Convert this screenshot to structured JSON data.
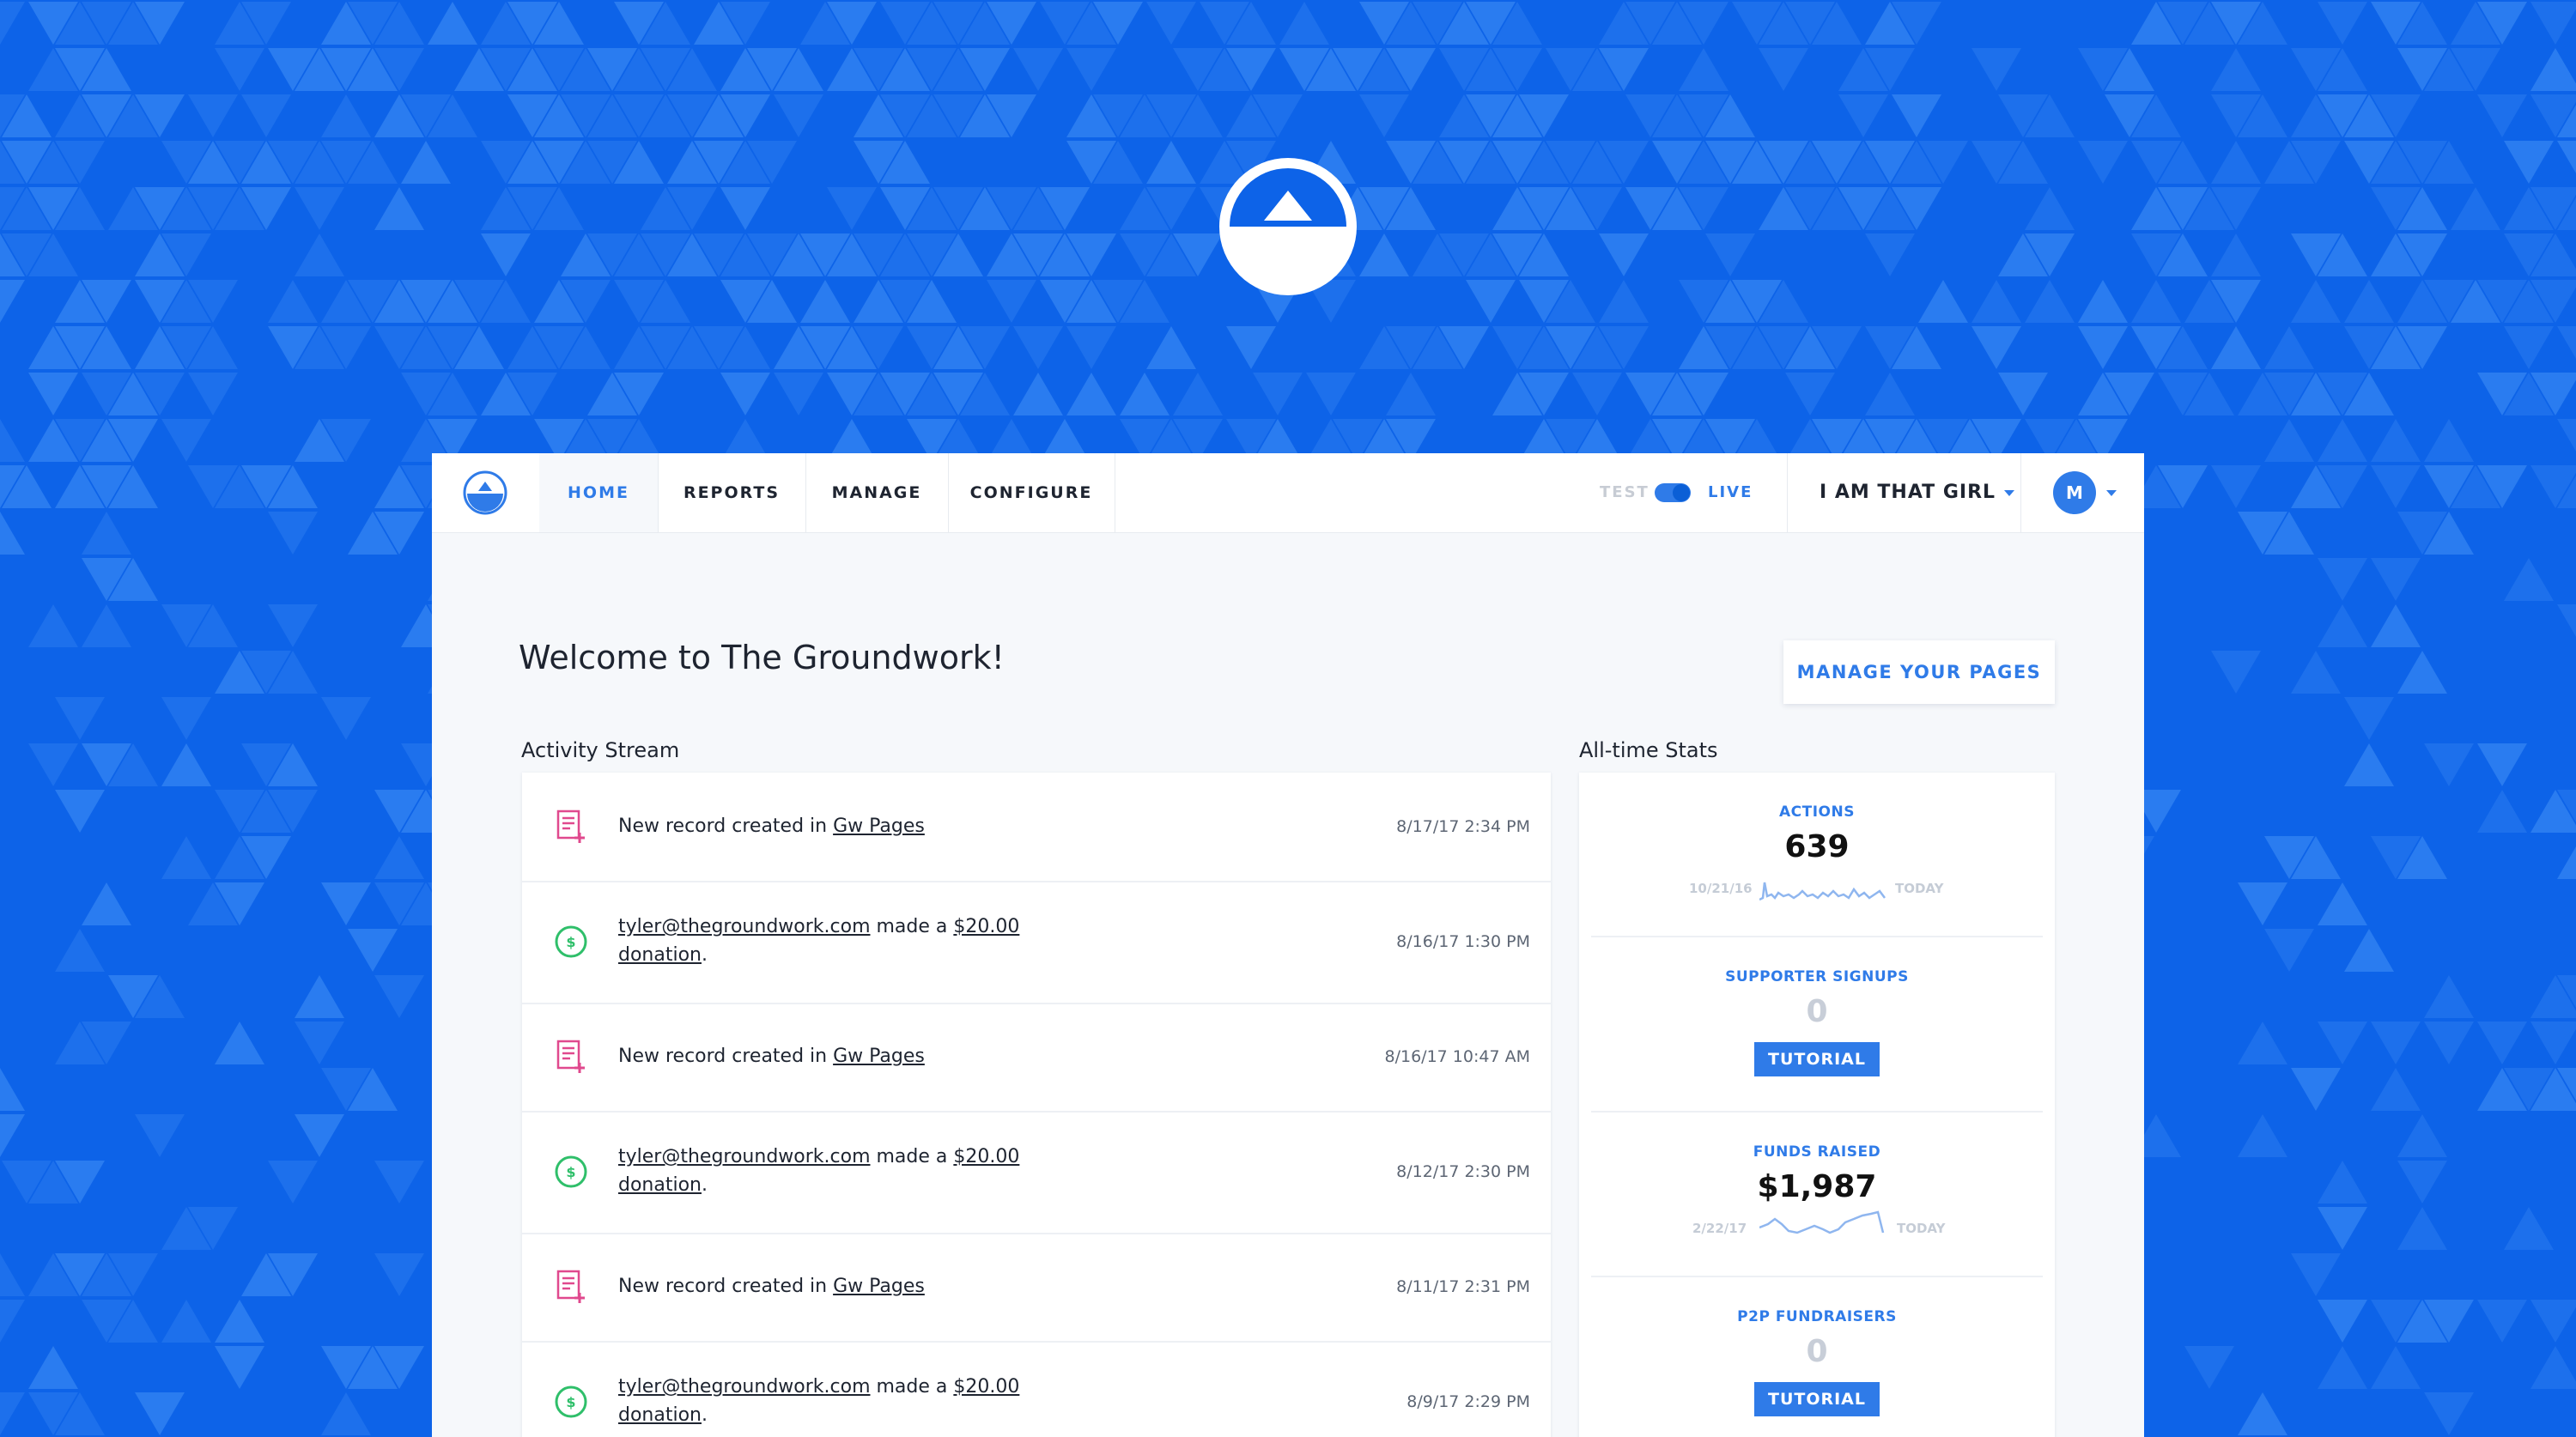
{
  "colors": {
    "background": "#0d63e8",
    "accent": "#2f7be8",
    "pink_icon": "#e0498e",
    "green_icon": "#2fbf6a"
  },
  "nav": {
    "home": "HOME",
    "reports": "REPORTS",
    "manage": "MANAGE",
    "configure": "CONFIGURE"
  },
  "mode": {
    "test": "TEST",
    "live": "LIVE",
    "current": "live"
  },
  "org": {
    "name": "I AM THAT GIRL"
  },
  "user": {
    "initial": "M"
  },
  "welcome": "Welcome to The Groundwork!",
  "manage_pages_button": "MANAGE YOUR PAGES",
  "activity": {
    "title": "Activity Stream",
    "rows": [
      {
        "icon": "record-icon",
        "prefix": "New record created in ",
        "link": "Gw Pages",
        "time": "8/17/17 2:34 PM"
      },
      {
        "icon": "donation-icon",
        "email": "tyler@thegroundwork.com",
        "middle": " made a ",
        "amount": "$20.00",
        "link2": "donation",
        "end": ".",
        "time": "8/16/17 1:30 PM"
      },
      {
        "icon": "record-icon",
        "prefix": "New record created in ",
        "link": "Gw Pages",
        "time": "8/16/17 10:47 AM"
      },
      {
        "icon": "donation-icon",
        "email": "tyler@thegroundwork.com",
        "middle": " made a ",
        "amount": "$20.00",
        "link2": "donation",
        "end": ".",
        "time": "8/12/17 2:30 PM"
      },
      {
        "icon": "record-icon",
        "prefix": "New record created in ",
        "link": "Gw Pages",
        "time": "8/11/17 2:31 PM"
      },
      {
        "icon": "donation-icon",
        "email": "tyler@thegroundwork.com",
        "middle": " made a ",
        "amount": "$20.00",
        "link2": "donation",
        "end": ".",
        "time": "8/9/17 2:29 PM"
      }
    ]
  },
  "stats": {
    "title": "All-time Stats",
    "actions": {
      "label": "ACTIONS",
      "value": "639",
      "from": "10/21/16",
      "to": "TODAY"
    },
    "signups": {
      "label": "SUPPORTER SIGNUPS",
      "value": "0",
      "button": "TUTORIAL"
    },
    "funds": {
      "label": "FUNDS RAISED",
      "value": "$1,987",
      "from": "2/22/17",
      "to": "TODAY"
    },
    "p2p": {
      "label": "P2P FUNDRAISERS",
      "value": "0",
      "button": "TUTORIAL"
    }
  }
}
